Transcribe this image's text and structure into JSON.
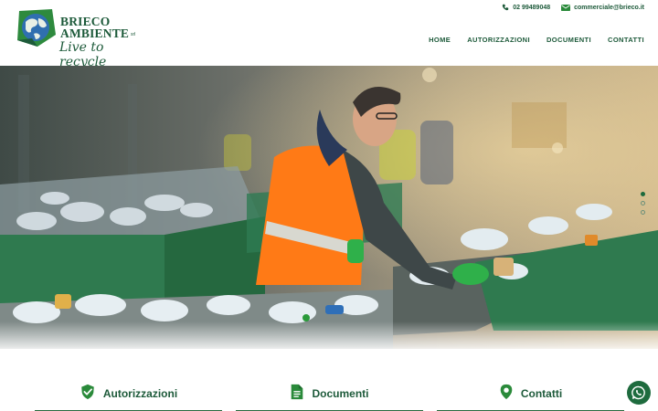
{
  "header": {
    "brand_line1": "BRIECO",
    "brand_line2": "AMBIENTE",
    "brand_suffix": "srl",
    "tagline": "Live to recycle",
    "phone": "02 99489048",
    "email": "commerciale@brieco.it"
  },
  "nav": {
    "items": [
      {
        "label": "HOME"
      },
      {
        "label": "AUTORIZZAZIONI"
      },
      {
        "label": "DOCUMENTI"
      },
      {
        "label": "CONTATTI"
      }
    ]
  },
  "hero": {
    "slides": 3,
    "active_slide": 1
  },
  "cards": [
    {
      "label": "Autorizzazioni",
      "icon": "shield-check-icon"
    },
    {
      "label": "Documenti",
      "icon": "document-icon"
    },
    {
      "label": "Contatti",
      "icon": "map-pin-icon"
    }
  ],
  "colors": {
    "brand_green": "#1d5a3a",
    "accent_green": "#2a8a3a",
    "whatsapp_bg": "#1e6b3e"
  },
  "whatsapp": {
    "icon": "whatsapp-icon"
  }
}
